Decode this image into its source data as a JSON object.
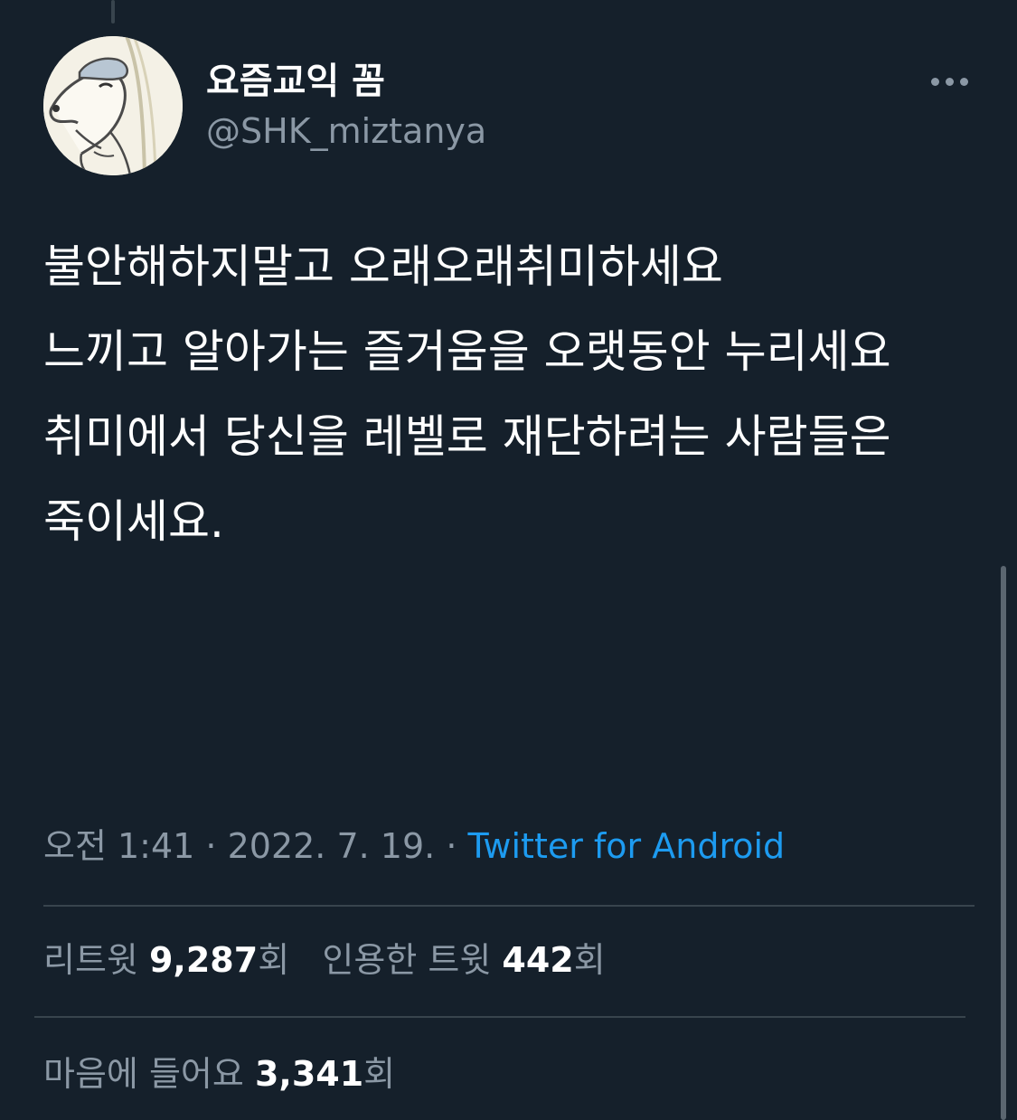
{
  "profile": {
    "display_name": "요즘교익 꼼",
    "handle": "@SHK_miztanya"
  },
  "tweet": {
    "lines": [
      "불안해하지말고 오래오래취미하세요",
      "느끼고 알아가는 즐거움을 오랫동안 누리세요",
      "취미에서 당신을 레벨로 재단하려는 사람들은",
      "죽이세요."
    ]
  },
  "meta": {
    "time": "오전 1:41",
    "separator": " · ",
    "date": "2022. 7. 19.",
    "source": "Twitter for Android"
  },
  "stats": {
    "retweets_label": "리트윗",
    "retweets_count": "9,287",
    "quotes_label": "인용한 트윗",
    "quotes_count": "442",
    "likes_label": "마음에 들어요",
    "likes_count": "3,341",
    "unit": "회"
  },
  "icons": {
    "more": "more-horizontal-icon"
  },
  "colors": {
    "background": "#15202b",
    "text_primary": "#ffffff",
    "text_secondary": "#8b98a5",
    "link": "#1d9bf0",
    "divider": "#38444d"
  }
}
